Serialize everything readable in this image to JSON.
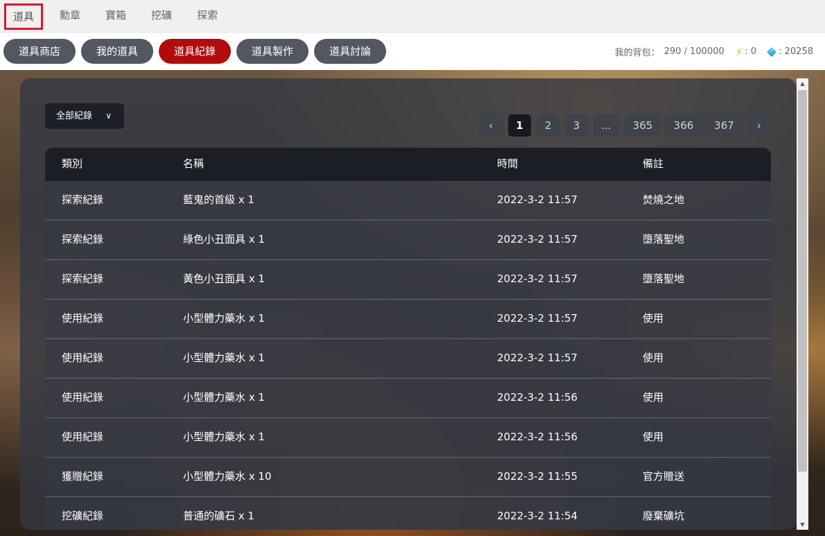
{
  "top_tabs": [
    "道具",
    "勳章",
    "寶箱",
    "挖礦",
    "探索"
  ],
  "sub_tabs": [
    "道具商店",
    "我的道具",
    "道具紀錄",
    "道具製作",
    "道具討論"
  ],
  "stats": {
    "bag_label": "我的背包：",
    "bag_value": "290 / 100000",
    "energy_value": ": 0",
    "gem_value": ": 20258"
  },
  "filter": {
    "label": "全部紀錄",
    "icon": "chevron-down-icon"
  },
  "pagination": {
    "prev_icon": "chevron-left-icon",
    "pages": [
      "1",
      "2",
      "3",
      "...",
      "365",
      "366",
      "367"
    ],
    "current": "1",
    "next_icon": "chevron-right-icon"
  },
  "table": {
    "headers": [
      "類別",
      "名稱",
      "時間",
      "備註"
    ],
    "rows": [
      [
        "探索紀錄",
        "藍鬼的首級 x 1",
        "2022-3-2 11:57",
        "焚燒之地"
      ],
      [
        "探索紀錄",
        "綠色小丑面具 x 1",
        "2022-3-2 11:57",
        "墮落聖地"
      ],
      [
        "探索紀錄",
        "黃色小丑面具 x 1",
        "2022-3-2 11:57",
        "墮落聖地"
      ],
      [
        "使用紀錄",
        "小型體力藥水 x 1",
        "2022-3-2 11:57",
        "使用"
      ],
      [
        "使用紀錄",
        "小型體力藥水 x 1",
        "2022-3-2 11:57",
        "使用"
      ],
      [
        "使用紀錄",
        "小型體力藥水 x 1",
        "2022-3-2 11:56",
        "使用"
      ],
      [
        "使用紀錄",
        "小型體力藥水 x 1",
        "2022-3-2 11:56",
        "使用"
      ],
      [
        "獲贈紀錄",
        "小型體力藥水 x 10",
        "2022-3-2 11:55",
        "官方贈送"
      ],
      [
        "挖礦紀錄",
        "普通的礦石 x 1",
        "2022-3-2 11:54",
        "廢棄礦坑"
      ]
    ]
  },
  "colors": {
    "accent_red": "#b30a0a",
    "highlight_border": "#e2142b"
  }
}
